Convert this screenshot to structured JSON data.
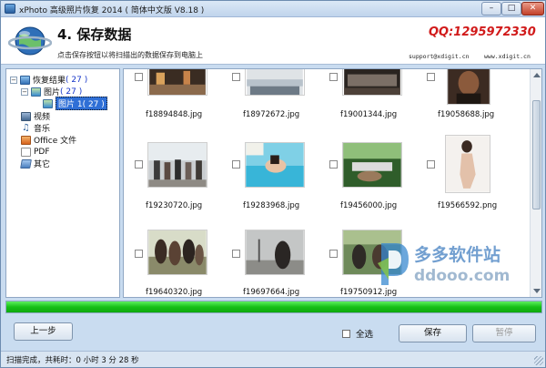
{
  "window": {
    "title": "xPhoto 高级照片恢复 2014 ( 简体中文版 V8.18 )",
    "minimize_glyph": "–",
    "maximize_glyph": "□",
    "close_glyph": "✕"
  },
  "header": {
    "step_title": "4. 保存数据",
    "subtitle": "点击保存按钮以将扫描出的数据保存到电脑上",
    "qq": "QQ:1295972330",
    "support": "support@xdigit.cn",
    "website": "www.xdigit.cn"
  },
  "tree": {
    "root": {
      "label": "恢复结果",
      "count": "( 27 )",
      "expander": "−"
    },
    "pictures": {
      "label": "图片",
      "count": "( 27 )",
      "expander": "−"
    },
    "pictures_child": {
      "label": "图片 1( 27 )"
    },
    "others": [
      {
        "label": "视频",
        "icon": "video-icon"
      },
      {
        "label": "音乐",
        "icon": "music-icon"
      },
      {
        "label": "Office 文件",
        "icon": "office-icon"
      },
      {
        "label": "PDF",
        "icon": "pdf-icon"
      },
      {
        "label": "其它",
        "icon": "other-icon"
      }
    ]
  },
  "files": [
    {
      "name": "f18894848.jpg"
    },
    {
      "name": "f18972672.jpg"
    },
    {
      "name": "f19001344.jpg"
    },
    {
      "name": "f19058688.jpg"
    },
    {
      "name": "f19230720.jpg"
    },
    {
      "name": "f19283968.jpg"
    },
    {
      "name": "f19456000.jpg"
    },
    {
      "name": "f19566592.png"
    },
    {
      "name": "f19640320.jpg"
    },
    {
      "name": "f19697664.jpg"
    },
    {
      "name": "f19750912.jpg"
    }
  ],
  "watermark": {
    "cn": "多多软件站",
    "en": "ddooo.com"
  },
  "progress": {
    "percent": 100
  },
  "buttons": {
    "prev": "上一步",
    "select_all": "全选",
    "save": "保存",
    "pause": "暂停"
  },
  "status": {
    "text": "扫描完成，共耗时：0 小时 3 分 28 秒"
  },
  "colors": {
    "accent_red": "#d11a1a",
    "progress_green": "#17c017",
    "tree_count_blue": "#1736c8"
  }
}
